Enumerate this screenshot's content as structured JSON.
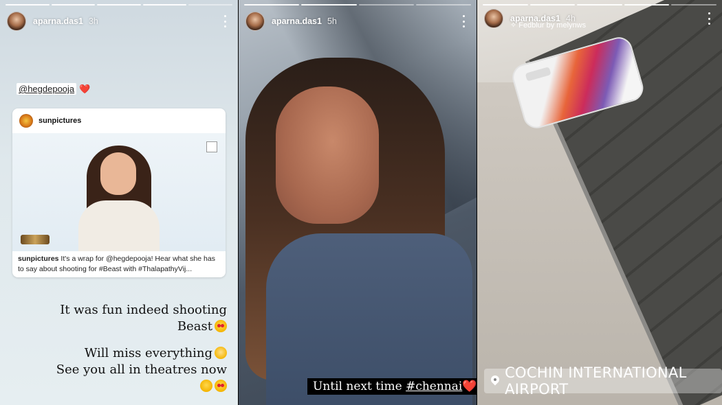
{
  "stories": [
    {
      "username": "aparna.das1",
      "time": "3h",
      "progress": [
        1,
        1,
        1,
        1,
        0.2
      ],
      "mention_tag": "@hegdepooja",
      "mention_emoji": "❤️",
      "card": {
        "username": "sunpictures",
        "caption_user": "sunpictures",
        "caption_text": " It's a wrap for @hegdepooja! Hear what she has to say about shooting for #Beast with #ThalapathyVij..."
      },
      "lines": [
        "It was fun indeed shooting",
        "Beast",
        "Will miss everything",
        "See you all in theatres now"
      ]
    },
    {
      "username": "aparna.das1",
      "time": "5h",
      "progress": [
        1,
        0.5,
        0,
        0
      ],
      "sticker_prefix": "Until next time ",
      "sticker_tag": "#chennai",
      "sticker_emoji": "❤️"
    },
    {
      "username": "aparna.das1",
      "time": "4h",
      "progress": [
        1,
        1,
        1,
        1,
        0
      ],
      "music_credit": "Fedblur by melynws",
      "location": "COCHIN INTERNATIONAL AIRPORT"
    }
  ],
  "icons": {
    "more": "more-vertical-icon",
    "location": "location-pin-icon",
    "music": "sparkle-music-icon"
  }
}
